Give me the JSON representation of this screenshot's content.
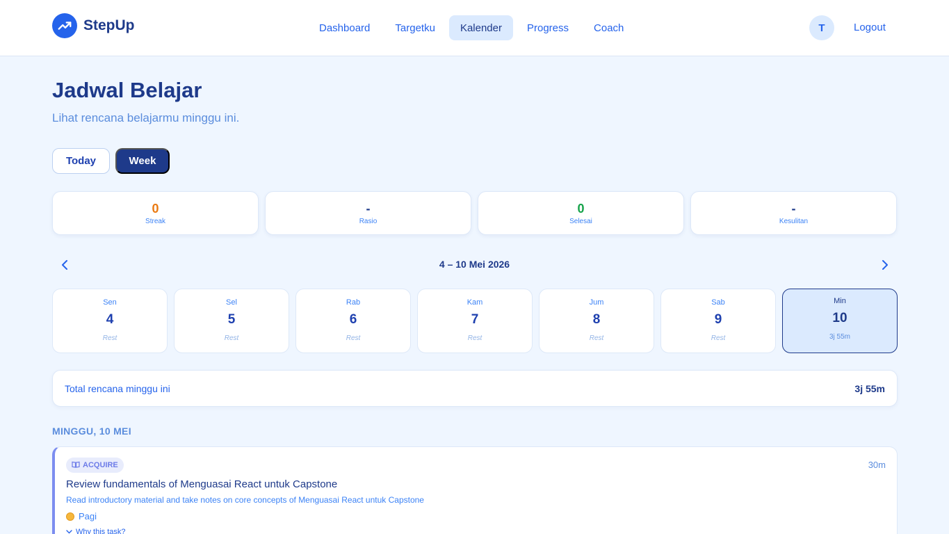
{
  "brand": {
    "name": "StepUp",
    "icon": "trending-up-icon"
  },
  "nav": {
    "items": [
      {
        "label": "Dashboard"
      },
      {
        "label": "Targetku"
      },
      {
        "label": "Kalender"
      },
      {
        "label": "Progress"
      },
      {
        "label": "Coach"
      }
    ],
    "active": "Kalender"
  },
  "user": {
    "avatar_initial": "T",
    "logout_label": "Logout"
  },
  "page": {
    "title": "Jadwal Belajar",
    "subtitle": "Lihat rencana belajarmu minggu ini."
  },
  "view_toggle": {
    "today": "Today",
    "week": "Week",
    "selected": "Week"
  },
  "stats": [
    {
      "value": "0",
      "label": "Streak",
      "color": "#ea7a12"
    },
    {
      "value": "-",
      "label": "Rasio",
      "color": "#1e3a8a"
    },
    {
      "value": "0",
      "label": "Selesai",
      "color": "#16a34a"
    },
    {
      "value": "-",
      "label": "Kesulitan",
      "color": "#1e3a8a"
    }
  ],
  "week": {
    "range": "4 – 10 Mei 2026",
    "days": [
      {
        "name": "Sen",
        "num": "4",
        "note": "Rest"
      },
      {
        "name": "Sel",
        "num": "5",
        "note": "Rest"
      },
      {
        "name": "Rab",
        "num": "6",
        "note": "Rest"
      },
      {
        "name": "Kam",
        "num": "7",
        "note": "Rest"
      },
      {
        "name": "Jum",
        "num": "8",
        "note": "Rest"
      },
      {
        "name": "Sab",
        "num": "9",
        "note": "Rest"
      },
      {
        "name": "Min",
        "num": "10",
        "note": "3j 55m"
      }
    ],
    "selected_day": "Min"
  },
  "total": {
    "label": "Total rencana minggu ini",
    "value": "3j 55m"
  },
  "section": {
    "date_label": "MINGGU, 10 MEI"
  },
  "task": {
    "badge": "ACQUIRE",
    "badge_icon": "book-icon",
    "duration": "30m",
    "title": "Review fundamentals of Menguasai React untuk Capstone",
    "description": "Read introductory material and take notes on core concepts of Menguasai React untuk Capstone",
    "time_of_day": "Pagi",
    "why_label": "Why this task?"
  },
  "colors": {
    "accent": "#2563eb",
    "navy": "#1e3a8a",
    "background": "#eff6ff",
    "task_accent": "#7c8df0"
  }
}
